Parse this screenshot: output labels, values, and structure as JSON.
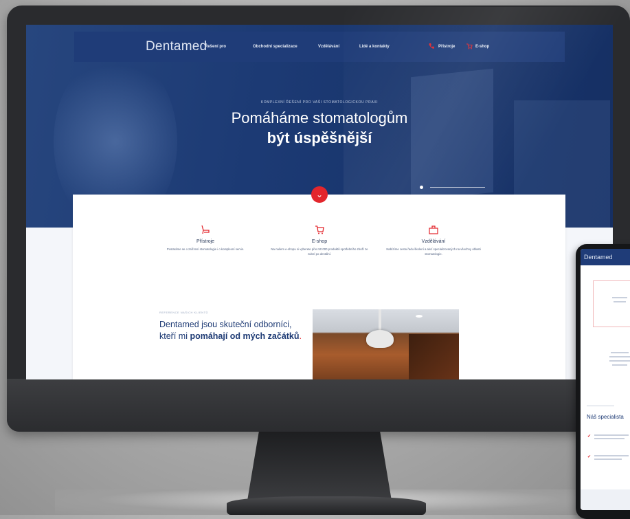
{
  "brand": {
    "name": "Dentamed",
    "primary": "#1f3c78",
    "accent": "#e3262c"
  },
  "nav": {
    "items": [
      "Řešení pro",
      "Obchodní specializace",
      "Vzdělávání",
      "Lidé a kontakty"
    ],
    "actions": [
      {
        "label": "Přístroje",
        "icon": "phone-icon"
      },
      {
        "label": "E-shop",
        "icon": "cart-icon"
      }
    ]
  },
  "hero": {
    "kicker": "KOMPLEXNÍ ŘEŠENÍ PRO VAŠI STOMATOLOGICKOU PRAXI",
    "line1": "Pomáháme stomatologům",
    "line2": "být úspěšnější"
  },
  "features": [
    {
      "icon": "dental-chair-icon",
      "title": "Přístroje",
      "desc": "Postaráme se o zařízení stomatologie i o komplexní servis."
    },
    {
      "icon": "cart-icon",
      "title": "E-shop",
      "desc": "Na našem e-shopu si vyberete přes 50 000 produktů spotřebního zboží ze zubní po dentální."
    },
    {
      "icon": "education-icon",
      "title": "Vzdělávání",
      "desc": "Nabízíme cestu řadu školení a akcí specializovaných na všechny oblasti stomatologie."
    }
  ],
  "testimonial": {
    "kicker": "REFERENCE NAŠICH KLIENTŮ",
    "text_a": "Dentamed jsou skuteční odborníci, kteří mi ",
    "text_b": "pomáhají od mých začátků",
    "text_c": "."
  },
  "phone": {
    "logo": "Dentamed",
    "heading": "Náš specialista"
  }
}
